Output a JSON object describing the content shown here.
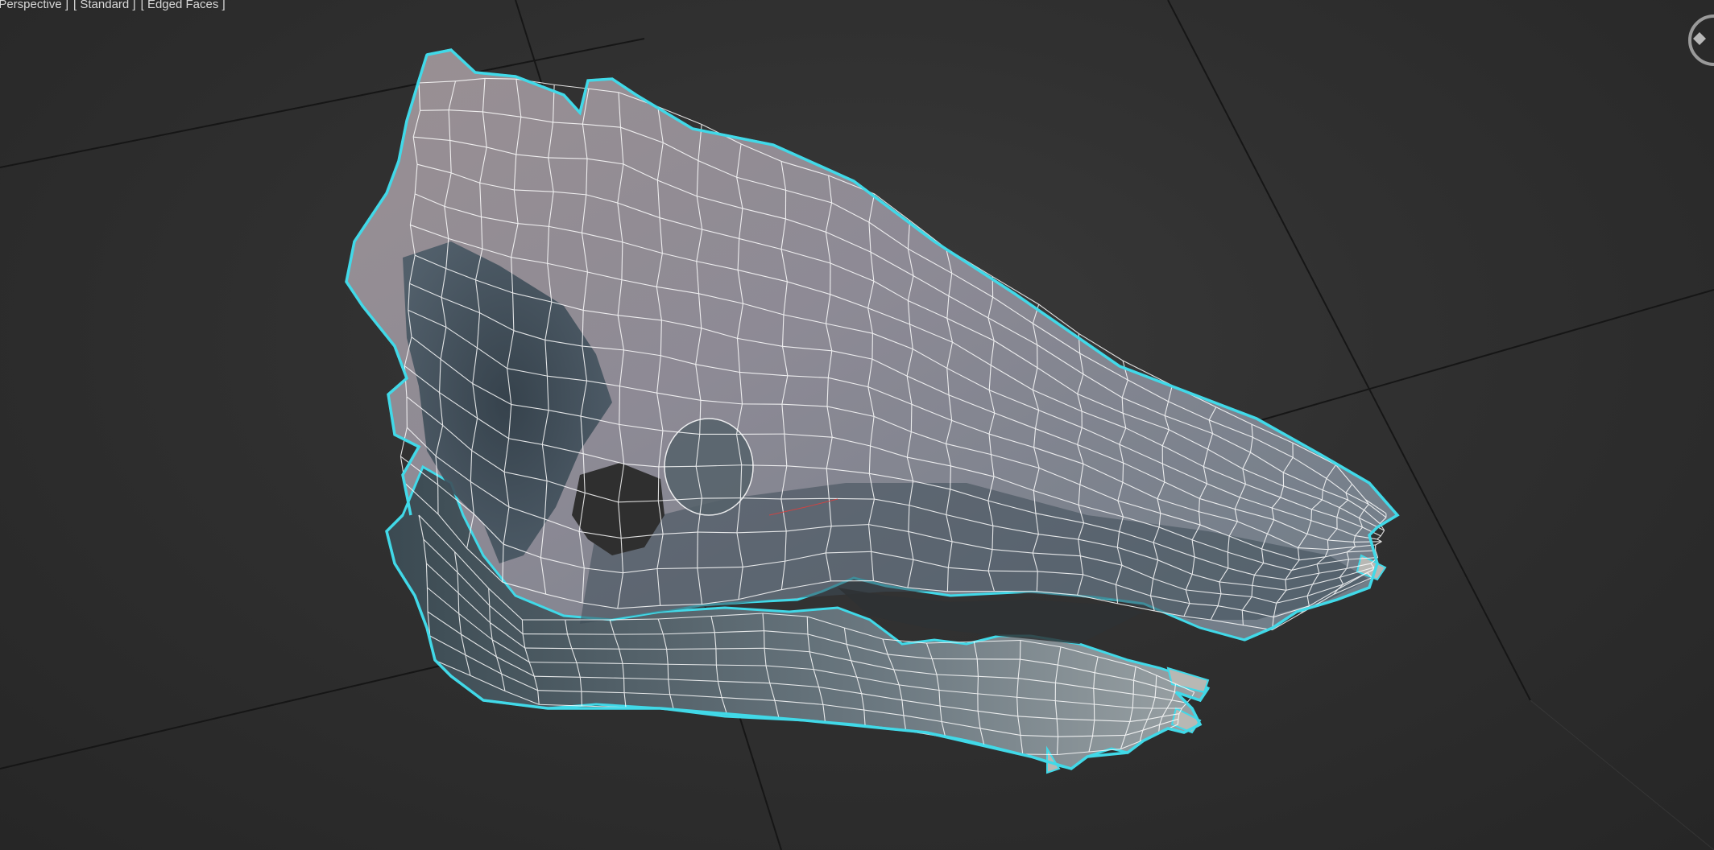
{
  "viewport": {
    "label_view": "[ Perspective ]",
    "label_shading": "[ Standard ]",
    "label_mode": "[ Edged Faces ]",
    "selected_object": "skull mesh",
    "selection_outline_color": "#41d9e8",
    "wire_color": "#ffffff",
    "grid_color": "#1a1a1a",
    "background_color": "#2f2f2f"
  },
  "icons": {
    "viewcube": "viewcube-icon"
  }
}
